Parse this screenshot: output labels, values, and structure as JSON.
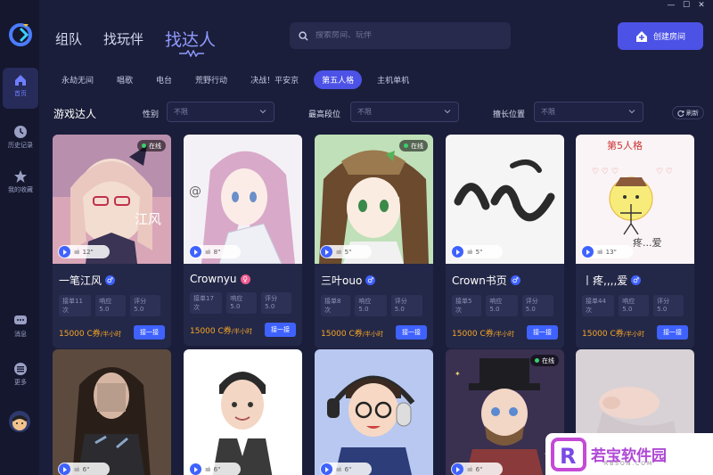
{
  "window": {
    "controls": [
      "minimize",
      "maximize",
      "close"
    ]
  },
  "sidebar": {
    "items": [
      {
        "label": "首页",
        "icon": "home-icon",
        "active": true
      },
      {
        "label": "历史记录",
        "icon": "clock-icon",
        "active": false
      },
      {
        "label": "我的收藏",
        "icon": "star-icon",
        "active": false
      },
      {
        "label": "消息",
        "icon": "chat-icon",
        "active": false
      },
      {
        "label": "更多",
        "icon": "more-icon",
        "active": false
      }
    ]
  },
  "topnav": {
    "items": [
      "组队",
      "找玩伴",
      "找达人"
    ],
    "active": "找达人"
  },
  "search": {
    "placeholder": "搜索房间、玩伴"
  },
  "create_button": {
    "label": "创建房间"
  },
  "tabs": [
    "永劫无间",
    "唱歌",
    "电台",
    "荒野行动",
    "决战！平安京",
    "第五人格",
    "主机单机"
  ],
  "active_tab": "第五人格",
  "filters": {
    "section_title": "游戏达人",
    "gender": {
      "label": "性别",
      "value": "不限"
    },
    "rank": {
      "label": "最高段位",
      "value": "不限"
    },
    "position": {
      "label": "擅长位置",
      "value": "不限"
    },
    "refresh": "刷新"
  },
  "cards": [
    {
      "name": "一笔江风",
      "gender": "m",
      "online": "在线",
      "voice": "12\"",
      "orders": "接单11次",
      "response": "响应 5.0",
      "rating": "评分 5.0",
      "price": "15000 C券",
      "unit": "/半小时",
      "book": "接一接"
    },
    {
      "name": "Crownyu",
      "gender": "f",
      "online": "",
      "voice": "8\"",
      "orders": "接单17次",
      "response": "响应 5.0",
      "rating": "评分 5.0",
      "price": "15000 C券",
      "unit": "/半小时",
      "book": "接一接"
    },
    {
      "name": "三叶ouo",
      "gender": "m",
      "online": "在线",
      "voice": "5\"",
      "orders": "接单8次",
      "response": "响应 5.0",
      "rating": "评分 5.0",
      "price": "15000 C券",
      "unit": "/半小时",
      "book": "接一接"
    },
    {
      "name": "Crown书页",
      "gender": "m",
      "online": "",
      "voice": "5\"",
      "orders": "接单5次",
      "response": "响应 5.0",
      "rating": "评分 5.0",
      "price": "15000 C券",
      "unit": "/半小时",
      "book": "接一接"
    },
    {
      "name": "丨疼,,,,爱",
      "gender": "m",
      "online": "",
      "voice": "13\"",
      "orders": "接单44次",
      "response": "响应 5.0",
      "rating": "评分 5.0",
      "price": "15000 C券",
      "unit": "/半小时",
      "book": "接一接"
    },
    {
      "name": "",
      "gender": "",
      "online": "",
      "voice": "6\"",
      "orders": "",
      "response": "",
      "rating": "",
      "price": "",
      "unit": "",
      "book": ""
    },
    {
      "name": "",
      "gender": "",
      "online": "",
      "voice": "6\"",
      "orders": "",
      "response": "",
      "rating": "",
      "price": "",
      "unit": "",
      "book": ""
    },
    {
      "name": "",
      "gender": "",
      "online": "",
      "voice": "6\"",
      "orders": "",
      "response": "",
      "rating": "",
      "price": "",
      "unit": "",
      "book": ""
    },
    {
      "name": "",
      "gender": "",
      "online": "在线",
      "voice": "6\"",
      "orders": "",
      "response": "",
      "rating": "",
      "price": "",
      "unit": "",
      "book": ""
    },
    {
      "name": "",
      "gender": "",
      "online": "",
      "voice": "",
      "orders": "",
      "response": "",
      "rating": "",
      "price": "",
      "unit": "",
      "book": ""
    }
  ],
  "card_art_text": {
    "jiangfeng": "江风",
    "doodle_title": "第5人格",
    "doodle_caption": "疼...爱"
  },
  "watermark": {
    "title": "若宝软件园",
    "sub": "RBSON.COM",
    "logo_letter": "R"
  },
  "colors": {
    "accent": "#4c52e6",
    "play": "#3f62ff",
    "price": "#f5a623",
    "online": "#3ad06b"
  }
}
